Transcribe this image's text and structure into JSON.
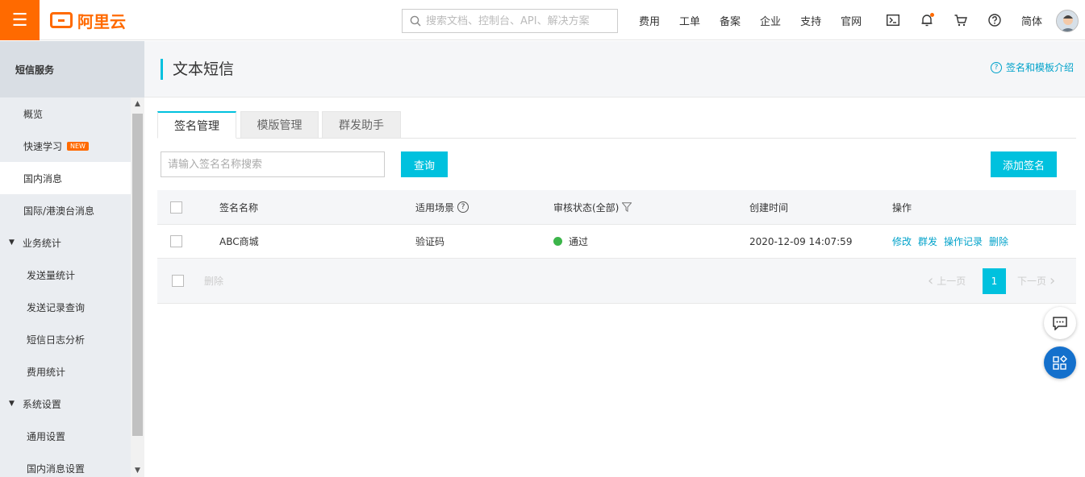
{
  "brand": {
    "name": "阿里云",
    "accent": "#ff6a00"
  },
  "search": {
    "placeholder": "搜索文档、控制台、API、解决方案"
  },
  "topnav": [
    "费用",
    "工单",
    "备案",
    "企业",
    "支持",
    "官网"
  ],
  "top_icons": [
    "terminal-icon",
    "bell-icon",
    "cart-icon",
    "help-icon"
  ],
  "language": "简体",
  "sidebar": {
    "title": "短信服务",
    "items": [
      {
        "label": "概览"
      },
      {
        "label": "快速学习",
        "badge": "NEW"
      },
      {
        "label": "国内消息",
        "active": true
      },
      {
        "label": "国际/港澳台消息"
      },
      {
        "label": "业务统计",
        "group": true
      },
      {
        "label": "发送量统计",
        "sub": true
      },
      {
        "label": "发送记录查询",
        "sub": true
      },
      {
        "label": "短信日志分析",
        "sub": true
      },
      {
        "label": "费用统计",
        "sub": true
      },
      {
        "label": "系统设置",
        "group": true
      },
      {
        "label": "通用设置",
        "sub": true
      },
      {
        "label": "国内消息设置",
        "sub": true
      }
    ]
  },
  "page": {
    "title": "文本短信",
    "help_link": "签名和模板介绍"
  },
  "tabs": [
    {
      "label": "签名管理",
      "active": true
    },
    {
      "label": "模版管理"
    },
    {
      "label": "群发助手"
    }
  ],
  "filter": {
    "input_placeholder": "请输入签名名称搜索",
    "query_button": "查询",
    "add_button": "添加签名"
  },
  "table": {
    "headers": {
      "name": "签名名称",
      "scene": "适用场景",
      "status": "审核状态(全部)",
      "created": "创建时间",
      "ops": "操作"
    },
    "rows": [
      {
        "name": "ABC商城",
        "scene": "验证码",
        "status": "通过",
        "created": "2020-12-09 14:07:59",
        "ops": [
          "修改",
          "群发",
          "操作记录",
          "删除"
        ]
      }
    ],
    "footer": {
      "delete": "删除",
      "prev": "上一页",
      "page": "1",
      "next": "下一页"
    }
  },
  "colors": {
    "primary": "#00c1de",
    "link": "#00a2ca",
    "success": "#3cb54a",
    "float_blue": "#1470cc"
  }
}
